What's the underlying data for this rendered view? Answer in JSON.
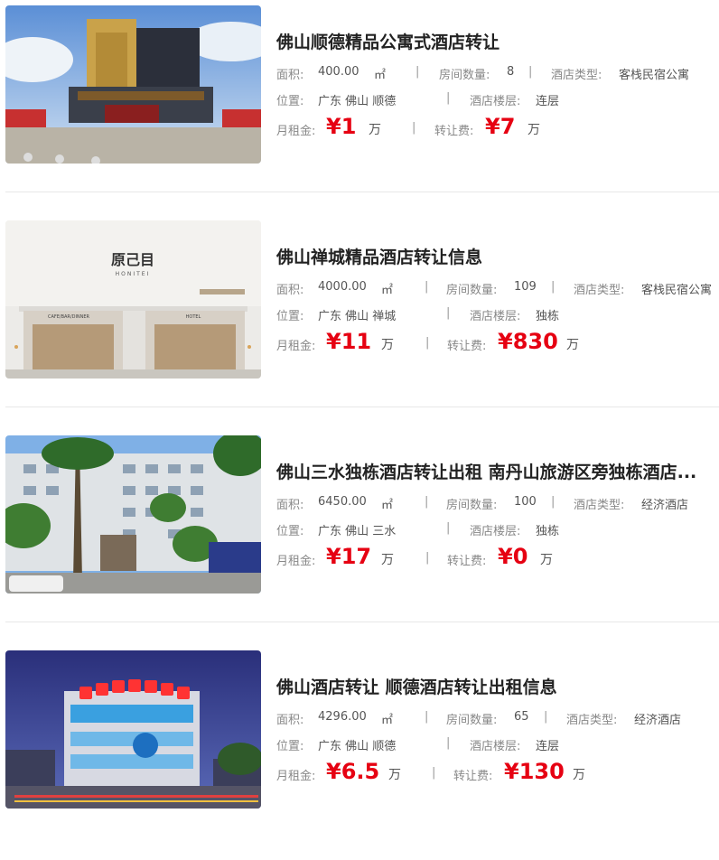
{
  "listings": [
    {
      "title": "佛山顺德精品公寓式酒店转让",
      "area_label": "面积:",
      "area": "400.00",
      "area_unit": "㎡",
      "rooms_label": "房间数量:",
      "rooms": "8",
      "type_label": "酒店类型:",
      "type": "客栈民宿公寓",
      "location_label": "位置:",
      "location": "广东 佛山 顺德",
      "floor_label": "酒店楼层:",
      "floor": "连层",
      "rent_label": "月租金:",
      "rent": "¥1",
      "rent_unit": "万",
      "fee_label": "转让费:",
      "fee": "¥7",
      "fee_unit": "万"
    },
    {
      "title": "佛山禅城精品酒店转让信息",
      "area_label": "面积:",
      "area": "4000.00",
      "area_unit": "㎡",
      "rooms_label": "房间数量:",
      "rooms": "109",
      "type_label": "酒店类型:",
      "type": "客栈民宿公寓",
      "location_label": "位置:",
      "location": "广东 佛山 禅城",
      "floor_label": "酒店楼层:",
      "floor": "独栋",
      "rent_label": "月租金:",
      "rent": "¥11",
      "rent_unit": "万",
      "fee_label": "转让费:",
      "fee": "¥830",
      "fee_unit": "万",
      "image_text": {
        "brand": "原己目",
        "brand_sub": "HONITEI",
        "sign_left": "CAFE/BAR/DINNER",
        "sign_right": "HOTEL"
      }
    },
    {
      "title": "佛山三水独栋酒店转让出租 南丹山旅游区旁独栋酒店...",
      "area_label": "面积:",
      "area": "6450.00",
      "area_unit": "㎡",
      "rooms_label": "房间数量:",
      "rooms": "100",
      "type_label": "酒店类型:",
      "type": "经济酒店",
      "location_label": "位置:",
      "location": "广东 佛山 三水",
      "floor_label": "酒店楼层:",
      "floor": "独栋",
      "rent_label": "月租金:",
      "rent": "¥17",
      "rent_unit": "万",
      "fee_label": "转让费:",
      "fee": "¥0",
      "fee_unit": "万"
    },
    {
      "title": "佛山酒店转让 顺德酒店转让出租信息",
      "area_label": "面积:",
      "area": "4296.00",
      "area_unit": "㎡",
      "rooms_label": "房间数量:",
      "rooms": "65",
      "type_label": "酒店类型:",
      "type": "经济酒店",
      "location_label": "位置:",
      "location": "广东 佛山 顺德",
      "floor_label": "酒店楼层:",
      "floor": "连层",
      "rent_label": "月租金:",
      "rent": "¥6.5",
      "rent_unit": "万",
      "fee_label": "转让费:",
      "fee": "¥130",
      "fee_unit": "万"
    }
  ],
  "separator": "|"
}
